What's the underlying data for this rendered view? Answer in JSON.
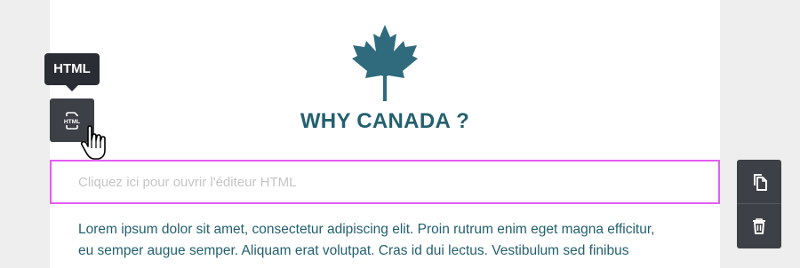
{
  "block": {
    "heading": "WHY CANADA ?",
    "html_placeholder": "Cliquez ici pour ouvrir l'éditeur HTML",
    "paragraph_lines": [
      "Lorem ipsum dolor sit amet, consectetur adipiscing elit. Proin rutrum enim eget magna efficitur,",
      "eu semper augue semper. Aliquam erat volutpat. Cras id dui lectus. Vestibulum sed finibus"
    ]
  },
  "toolbar": {
    "tooltip": "HTML",
    "html_icon_text": "HTML",
    "icons": [
      "html-icon",
      "copy-icon",
      "trash-icon"
    ]
  },
  "colors": {
    "accent_teal": "#23606e",
    "leaf": "#2f6b7d",
    "selection_border": "#e25ef0",
    "toolbar_bg": "#3d4046",
    "tooltip_bg": "#2a2d33"
  }
}
